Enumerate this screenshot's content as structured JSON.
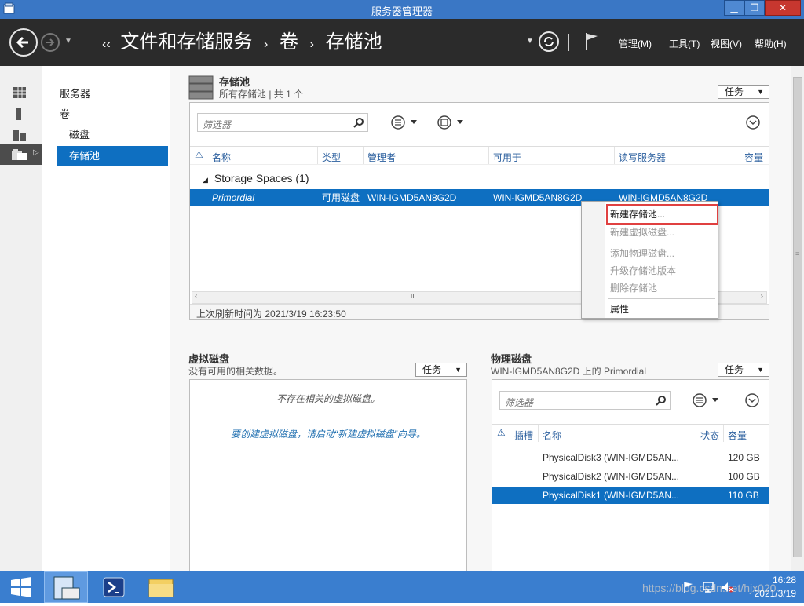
{
  "window": {
    "title": "服务器管理器",
    "min": "▁",
    "restore": "❐",
    "close": "✕"
  },
  "nav": {
    "breadcrumb_prefix": "‹‹",
    "crumbs": [
      "文件和存储服务",
      "卷",
      "存储池"
    ],
    "separator": "›",
    "menus": [
      "管理(M)",
      "工具(T)",
      "视图(V)",
      "帮助(H)"
    ]
  },
  "sidebar": {
    "icons": [
      "dashboard-icon",
      "local-server-icon",
      "all-servers-icon",
      "file-storage-icon"
    ]
  },
  "navpane": {
    "items": [
      "服务器",
      "卷",
      "磁盘",
      "存储池"
    ]
  },
  "storage_pools": {
    "title": "存储池",
    "subtitle": "所有存储池 | 共 1 个",
    "task_label": "任务",
    "filter_placeholder": "筛选器",
    "columns": [
      "名称",
      "类型",
      "管理者",
      "可用于",
      "读写服务器",
      "容量"
    ],
    "group_label": "Storage Spaces (1)",
    "rows": [
      {
        "name": "Primordial",
        "type": "可用磁盘",
        "manager": "WIN-IGMD5AN8G2D",
        "available": "WIN-IGMD5AN8G2D",
        "rw_server": "WIN-IGMD5AN8G2D",
        "capacity": ""
      }
    ],
    "refresh_text": "上次刷新时间为 2021/3/19 16:23:50",
    "scroll_mid": "III"
  },
  "context_menu": {
    "items": [
      {
        "label": "新建存储池...",
        "enabled": true,
        "highlighted": true
      },
      {
        "label": "新建虚拟磁盘...",
        "enabled": false
      },
      {
        "label": "添加物理磁盘...",
        "enabled": false
      },
      {
        "label": "升级存储池版本",
        "enabled": false
      },
      {
        "label": "删除存储池",
        "enabled": false
      },
      {
        "label": "属性",
        "enabled": true
      }
    ],
    "highlight_color": "#e04040"
  },
  "virtual_disks": {
    "title": "虚拟磁盘",
    "subtitle": "没有可用的相关数据。",
    "task_label": "任务",
    "empty_text": "不存在相关的虚拟磁盘。",
    "hint_text": "要创建虚拟磁盘，请启动“新建虚拟磁盘”向导。"
  },
  "physical_disks": {
    "title": "物理磁盘",
    "subtitle": "WIN-IGMD5AN8G2D 上的 Primordial",
    "task_label": "任务",
    "filter_placeholder": "筛选器",
    "columns": [
      "插槽",
      "名称",
      "状态",
      "容量"
    ],
    "rows": [
      {
        "name": "PhysicalDisk3 (WIN-IGMD5AN...",
        "capacity": "120 GB",
        "selected": false
      },
      {
        "name": "PhysicalDisk2 (WIN-IGMD5AN...",
        "capacity": "100 GB",
        "selected": false
      },
      {
        "name": "PhysicalDisk1 (WIN-IGMD5AN...",
        "capacity": "110 GB",
        "selected": true
      }
    ]
  },
  "taskbar": {
    "clock_time": "16:28",
    "clock_date": "2021/3/19",
    "watermark": "https://blog.csdn.net/hjx020"
  },
  "colors": {
    "accent": "#0e6fc1",
    "titlebar": "#3a77c5",
    "navbar": "#2b2b2b",
    "taskbar": "#3a7ecf"
  }
}
